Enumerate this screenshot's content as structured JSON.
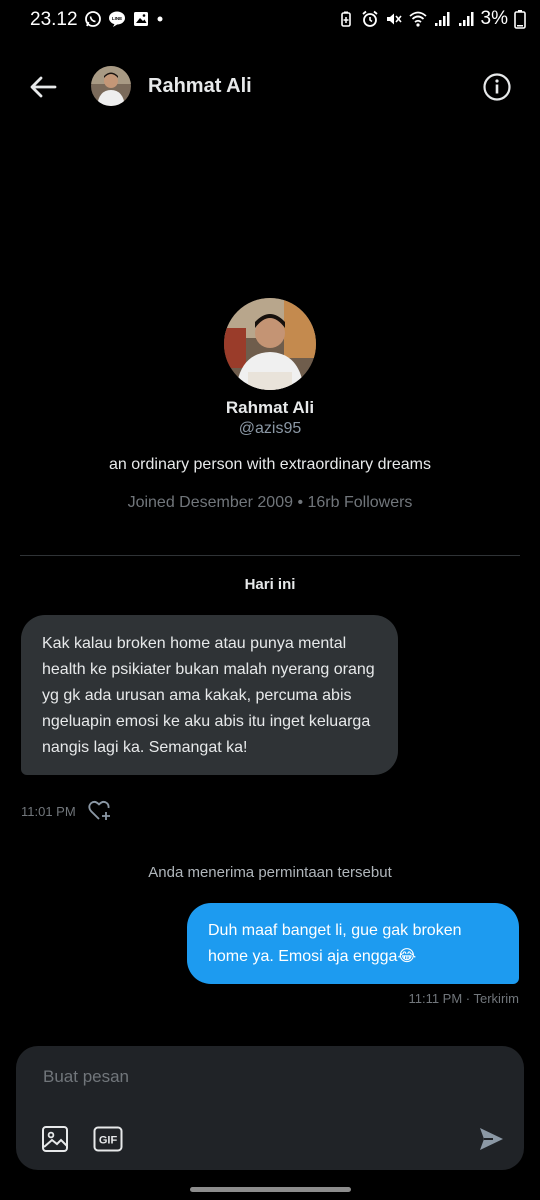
{
  "status_bar": {
    "time": "23.12",
    "battery": "3%",
    "left_icons": [
      "whatsapp-icon",
      "line-icon",
      "gallery-icon",
      "dot-icon"
    ],
    "right_icons": [
      "battery-saver-icon",
      "alarm-icon",
      "mute-icon",
      "wifi-icon",
      "signal-icon",
      "signal-icon",
      "battery-icon"
    ]
  },
  "header": {
    "name": "Rahmat Ali"
  },
  "profile": {
    "name": "Rahmat Ali",
    "handle": "@azis95",
    "bio": "an ordinary person with extraordinary dreams",
    "meta": "Joined Desember 2009 • 16rb Followers"
  },
  "conversation": {
    "day_label": "Hari ini",
    "incoming": {
      "text": "Kak kalau broken home atau punya mental health ke psikiater bukan malah nyerang orang yg gk ada urusan ama kakak, percuma abis ngeluapin emosi ke aku abis itu inget keluarga nangis lagi ka. Semangat ka!",
      "time": "11:01 PM"
    },
    "system_message": "Anda menerima permintaan tersebut",
    "outgoing": {
      "text": "Duh maaf banget li, gue gak broken home ya. Emosi aja engga😂",
      "meta": "11:11 PM · Terkirim"
    }
  },
  "composer": {
    "placeholder": "Buat pesan",
    "gif_label": "GIF"
  },
  "colors": {
    "background": "#000000",
    "incoming_bubble": "#2f3336",
    "outgoing_bubble": "#1d9bf0",
    "composer": "#202327",
    "muted_text": "#71767b"
  }
}
